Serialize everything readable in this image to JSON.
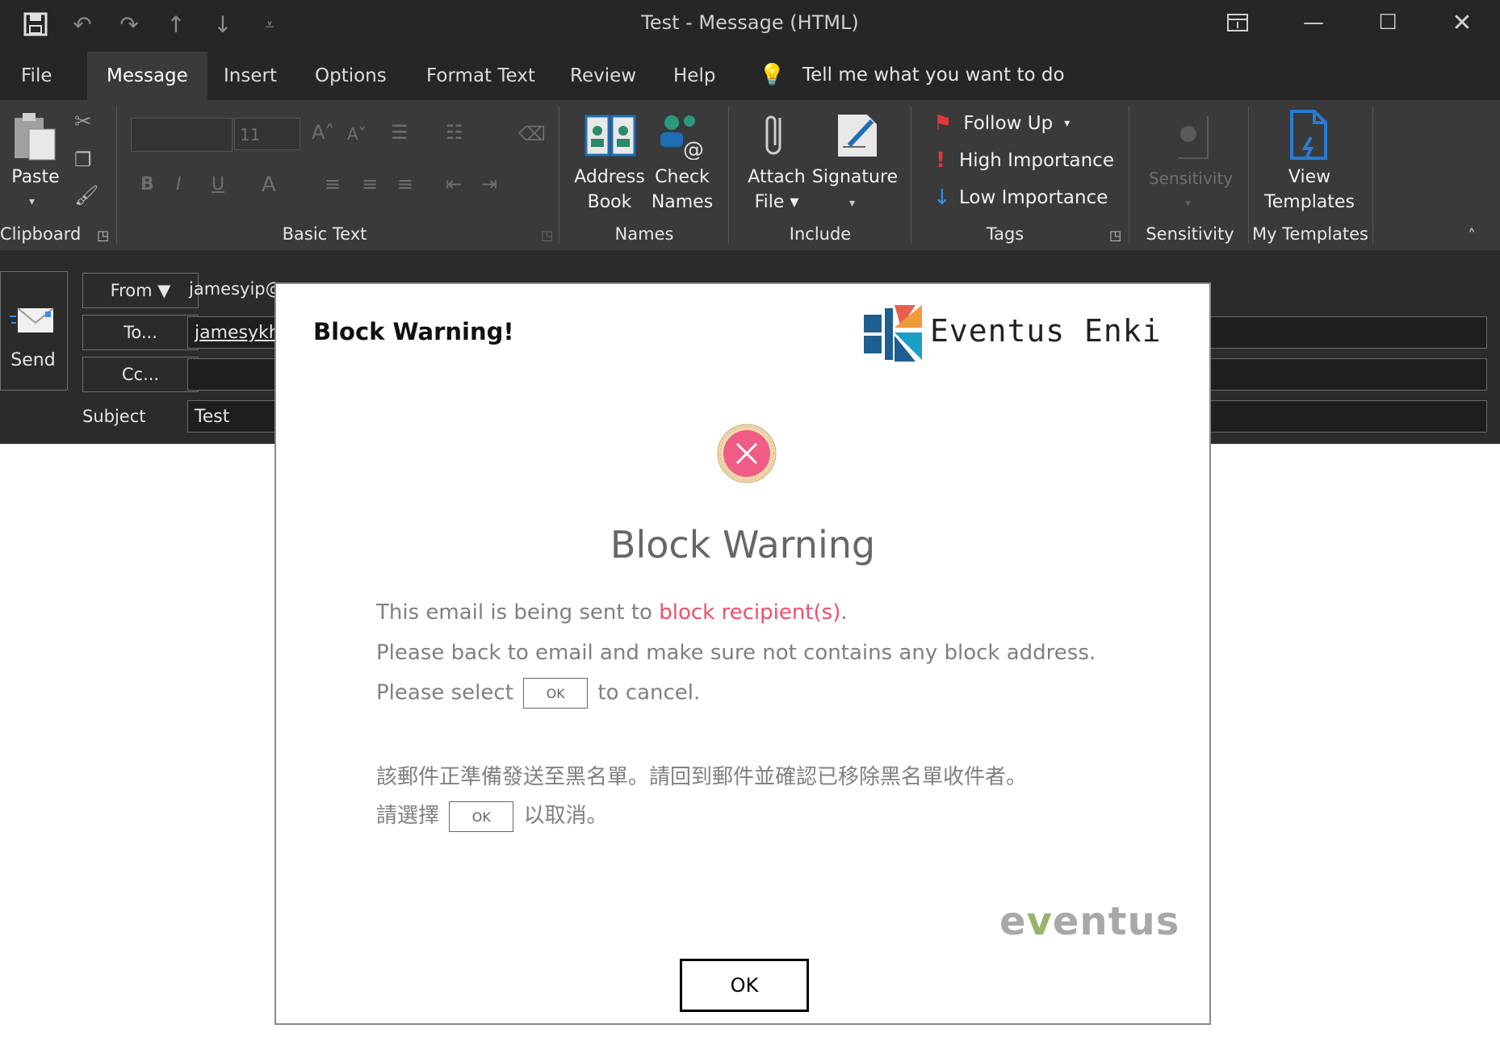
{
  "window": {
    "title": "Test  -  Message (HTML)"
  },
  "menu": {
    "tabs": [
      {
        "label": "File"
      },
      {
        "label": "Message"
      },
      {
        "label": "Insert"
      },
      {
        "label": "Options"
      },
      {
        "label": "Format Text"
      },
      {
        "label": "Review"
      },
      {
        "label": "Help"
      }
    ],
    "tell_me": "Tell me what you want to do"
  },
  "ribbon": {
    "clipboard": {
      "paste": "Paste",
      "group": "Clipboard"
    },
    "basic_text": {
      "font_size": "11",
      "group": "Basic Text"
    },
    "names": {
      "address_book_1": "Address",
      "address_book_2": "Book",
      "check_names_1": "Check",
      "check_names_2": "Names",
      "group": "Names"
    },
    "include": {
      "attach_1": "Attach",
      "attach_2": "File",
      "signature": "Signature",
      "group": "Include"
    },
    "tags": {
      "follow_up": "Follow Up",
      "high": "High Importance",
      "low": "Low Importance",
      "group": "Tags"
    },
    "sensitivity": {
      "label": "Sensitivity",
      "group": "Sensitivity"
    },
    "templates": {
      "view_1": "View",
      "view_2": "Templates",
      "group": "My Templates"
    }
  },
  "compose": {
    "send": "Send",
    "from_button": "From",
    "from_value": "jamesyip@",
    "to_button": "To...",
    "to_value": "jamesykh(",
    "cc_button": "Cc...",
    "subject_label": "Subject",
    "subject_value": "Test"
  },
  "dialog": {
    "title": "Block Warning!",
    "brand": "Eventus Enki",
    "heading": "Block Warning",
    "line1_prefix": "This email is being sent to ",
    "line1_highlight": "block recipient(s)",
    "line1_suffix": ".",
    "line2": "Please back to email and make sure not contains any block address.",
    "line3_prefix": "Please select",
    "line3_suffix": "to cancel.",
    "chip_label": "OK",
    "zh_line1": "該郵件正準備發送至黑名單。請回到郵件並確認已移除黑名單收件者。",
    "zh_line2_prefix": "請選擇",
    "zh_line2_suffix": "以取消。",
    "logo_part1": "e",
    "logo_part2": "v",
    "logo_part3": "entus",
    "ok_label": "OK"
  },
  "colors": {
    "highlight_red": "#ef4f6a",
    "titlebar": "#262626",
    "ribbon": "#3a3a3a",
    "logo_green": "#9ab46b"
  }
}
